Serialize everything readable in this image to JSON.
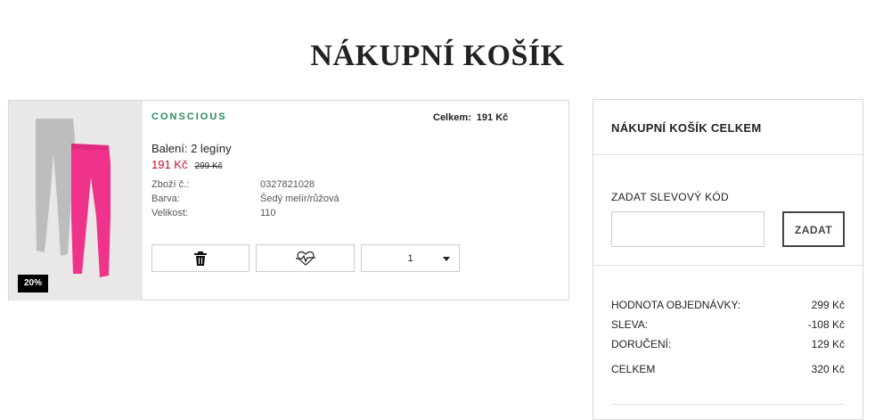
{
  "page_title": "NÁKUPNÍ KOŠÍK",
  "cart_item": {
    "tag": "CONSCIOUS",
    "total_label": "Celkem:",
    "total_value": "191 Kč",
    "name": "Balení: 2 legíny",
    "price_current": "191 Kč",
    "price_old": "299 Kč",
    "discount_badge": "20%",
    "details": [
      {
        "label": "Zboží č.:",
        "value": "0327821028"
      },
      {
        "label": "Barva:",
        "value": "Šedý melír/růžová"
      },
      {
        "label": "Velikost:",
        "value": "110"
      }
    ],
    "quantity": "1",
    "icons": {
      "delete": "trash-icon",
      "favorite": "heart-off-icon",
      "dropdown": "caret-down-icon"
    }
  },
  "summary": {
    "title": "NÁKUPNÍ KOŠÍK CELKEM",
    "promo_label": "ZADAT SLEVOVÝ KÓD",
    "promo_placeholder": "",
    "promo_button": "ZADAT",
    "rows": [
      {
        "label": "HODNOTA OBJEDNÁVKY:",
        "value": "299 Kč"
      },
      {
        "label": "SLEVA:",
        "value": "-108 Kč"
      },
      {
        "label": "DORUČENÍ:",
        "value": "129 Kč"
      },
      {
        "label": "CELKEM",
        "value": "320 Kč"
      }
    ]
  },
  "colors": {
    "sale_red": "#c8102e",
    "conscious_green": "#2e8b57",
    "leggings_gray": "#bdbdbd",
    "leggings_pink": "#f0338a"
  }
}
